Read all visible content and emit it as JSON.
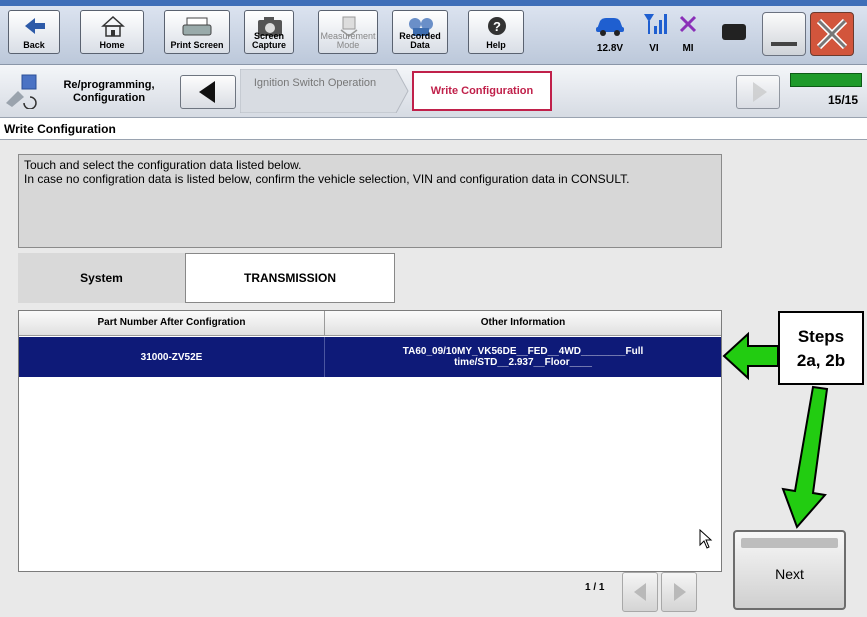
{
  "toolbar": {
    "back_label": "Back",
    "home_label": "Home",
    "print_label": "Print Screen",
    "capture_label": "Screen Capture",
    "measurement_label": "Measurement Mode",
    "recorded_label": "Recorded Data",
    "help_label": "Help"
  },
  "status": {
    "voltage": "12.8V",
    "vi_label": "VI",
    "mi_label": "MI"
  },
  "breadcrumb": {
    "step1": "Re/programming, Configuration",
    "step2": "Ignition Switch Operation",
    "step3": "Write Configuration",
    "page": "15/15"
  },
  "heading": "Write Configuration",
  "instructions": "Touch and select the configuration data listed below.\nIn case no configration data is listed below, confirm the vehicle selection, VIN and configuration data in CONSULT.",
  "system": {
    "label": "System",
    "value": "TRANSMISSION"
  },
  "table": {
    "columns": [
      "Part Number After Configration",
      "Other Information"
    ],
    "rows": [
      {
        "part_number": "31000-ZV52E",
        "other_info": "TA60_09/10MY_VK56DE__FED__4WD________Full time/STD__2.937__Floor____"
      }
    ]
  },
  "pager": {
    "text": "1 / 1"
  },
  "next_label": "Next",
  "annotation": {
    "line1": "Steps",
    "line2": "2a, 2b",
    "arrow_color": "#22cc11"
  },
  "colors": {
    "selected_row": "#0e1a78",
    "active_tab_border": "#c0204a",
    "close_button": "#d2553c"
  }
}
